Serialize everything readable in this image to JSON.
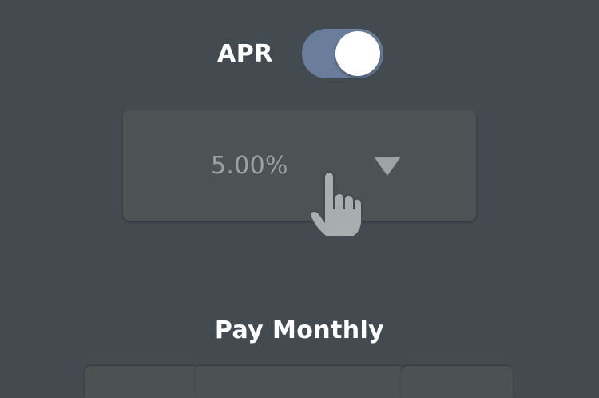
{
  "apr": {
    "label": "APR",
    "toggle_on": true,
    "toggle_color": "#6a7e9c"
  },
  "rate_select": {
    "value": "5.00%",
    "caret_icon": "triangle-down-icon"
  },
  "cursor": {
    "icon": "hand-pointer-icon"
  },
  "section": {
    "title": "Pay Monthly"
  },
  "tabs": [
    {
      "label": ""
    },
    {
      "label": ""
    },
    {
      "label": ""
    }
  ]
}
